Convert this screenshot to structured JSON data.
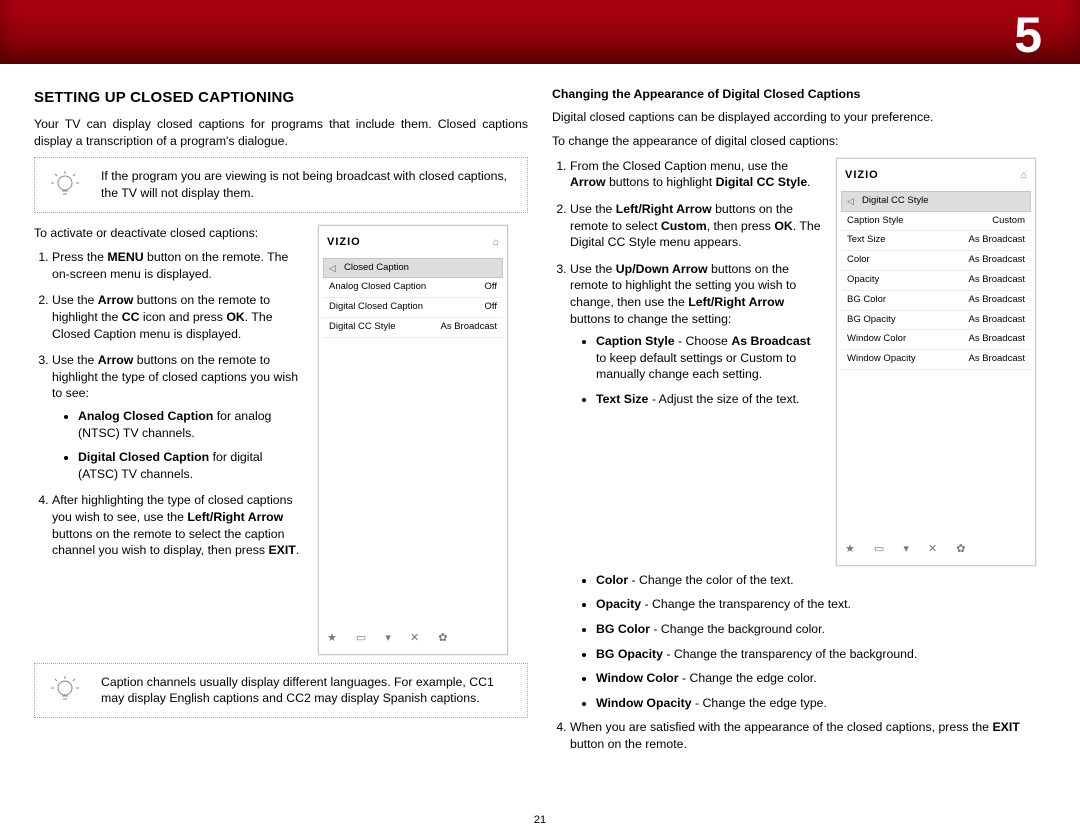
{
  "chapter_number": "5",
  "page_number": "21",
  "left": {
    "heading": "SETTING UP CLOSED CAPTIONING",
    "intro": "Your TV can display closed captions for programs that include them. Closed captions display a transcription of a program's dialogue.",
    "note1": "If the program you are viewing is not being broadcast with closed captions, the TV will not display them.",
    "activate_line": "To activate or deactivate closed captions:",
    "step1_a": "Press the ",
    "step1_b": "MENU",
    "step1_c": " button on the remote. The on-screen menu is displayed.",
    "step2_a": "Use the ",
    "step2_b": "Arrow",
    "step2_c": " buttons on the remote to highlight the ",
    "step2_d": "CC",
    "step2_e": " icon and press ",
    "step2_f": "OK",
    "step2_g": ". The Closed Caption menu is displayed.",
    "step3_a": "Use the ",
    "step3_b": "Arrow",
    "step3_c": " buttons on the remote to highlight the type of closed captions you wish to see:",
    "bullet_a1": "Analog Closed Caption",
    "bullet_a2": " for analog (NTSC) TV channels.",
    "bullet_d1": "Digital Closed Caption",
    "bullet_d2": " for digital (ATSC) TV channels.",
    "step4_a": "After highlighting the type of closed captions you wish to see, use the ",
    "step4_b": "Left/Right Arrow",
    "step4_c": " buttons on the remote to select the caption channel you wish to display, then press ",
    "step4_d": "EXIT",
    "step4_e": ".",
    "note2": "Caption channels usually display different languages. For example, CC1 may display English captions and CC2 may display Spanish captions.",
    "screen": {
      "logo": "VIZIO",
      "title": "Closed Caption",
      "rows": [
        {
          "label": "Analog Closed Caption",
          "value": "Off"
        },
        {
          "label": "Digital Closed Caption",
          "value": "Off"
        },
        {
          "label": "Digital CC Style",
          "value": "As Broadcast"
        }
      ],
      "footer_icons": "★ ▭ ▾ ✕ ✿"
    }
  },
  "right": {
    "heading": "Changing the Appearance of Digital Closed Captions",
    "intro": "Digital closed captions can be displayed according to your preference.",
    "change_line": "To change the appearance of digital closed captions:",
    "step1_a": "From the Closed Caption menu, use the ",
    "step1_b": "Arrow",
    "step1_c": " buttons to highlight ",
    "step1_d": "Digital CC Style",
    "step1_e": ".",
    "step2_a": "Use the ",
    "step2_b": "Left/Right Arrow",
    "step2_c": " buttons on the remote to select ",
    "step2_d": "Custom",
    "step2_e": ", then press ",
    "step2_f": "OK",
    "step2_g": ". The Digital CC Style menu appears.",
    "step3_a": "Use the ",
    "step3_b": "Up/Down Arrow",
    "step3_c": " buttons on the remote to highlight the setting you wish to change, then use the ",
    "step3_d": "Left/Right Arrow",
    "step3_e": " buttons to change the setting:",
    "s_caption_b": "Caption Style",
    "s_caption_t1": " - Choose ",
    "s_caption_b2": "As Broadcast",
    "s_caption_t2": " to keep default settings or Custom to manually change each setting.",
    "s_text_b": "Text Size",
    "s_text_t": " - Adjust the size of the text.",
    "s_color_b": "Color",
    "s_color_t": " - Change the color of the text.",
    "s_opacity_b": "Opacity",
    "s_opacity_t": " - Change the transparency of the text.",
    "s_bgcolor_b": "BG Color",
    "s_bgcolor_t": " - Change the background color.",
    "s_bgop_b": "BG Opacity",
    "s_bgop_t": " - Change the transparency of the background.",
    "s_wcolor_b": "Window Color",
    "s_wcolor_t": " - Change the edge color.",
    "s_wop_b": "Window Opacity",
    "s_wop_t": " - Change the edge type.",
    "step4_a": "When you are satisfied with the appearance of the closed captions, press the ",
    "step4_b": "EXIT",
    "step4_c": " button on the remote.",
    "screen": {
      "logo": "VIZIO",
      "title": "Digital CC Style",
      "rows": [
        {
          "label": "Caption Style",
          "value": "Custom"
        },
        {
          "label": "Text Size",
          "value": "As Broadcast"
        },
        {
          "label": "Color",
          "value": "As Broadcast"
        },
        {
          "label": "Opacity",
          "value": "As Broadcast"
        },
        {
          "label": "BG Color",
          "value": "As Broadcast"
        },
        {
          "label": "BG Opacity",
          "value": "As Broadcast"
        },
        {
          "label": "Window Color",
          "value": "As Broadcast"
        },
        {
          "label": "Window Opacity",
          "value": "As Broadcast"
        }
      ],
      "footer_icons": "★ ▭ ▾ ✕ ✿"
    }
  }
}
